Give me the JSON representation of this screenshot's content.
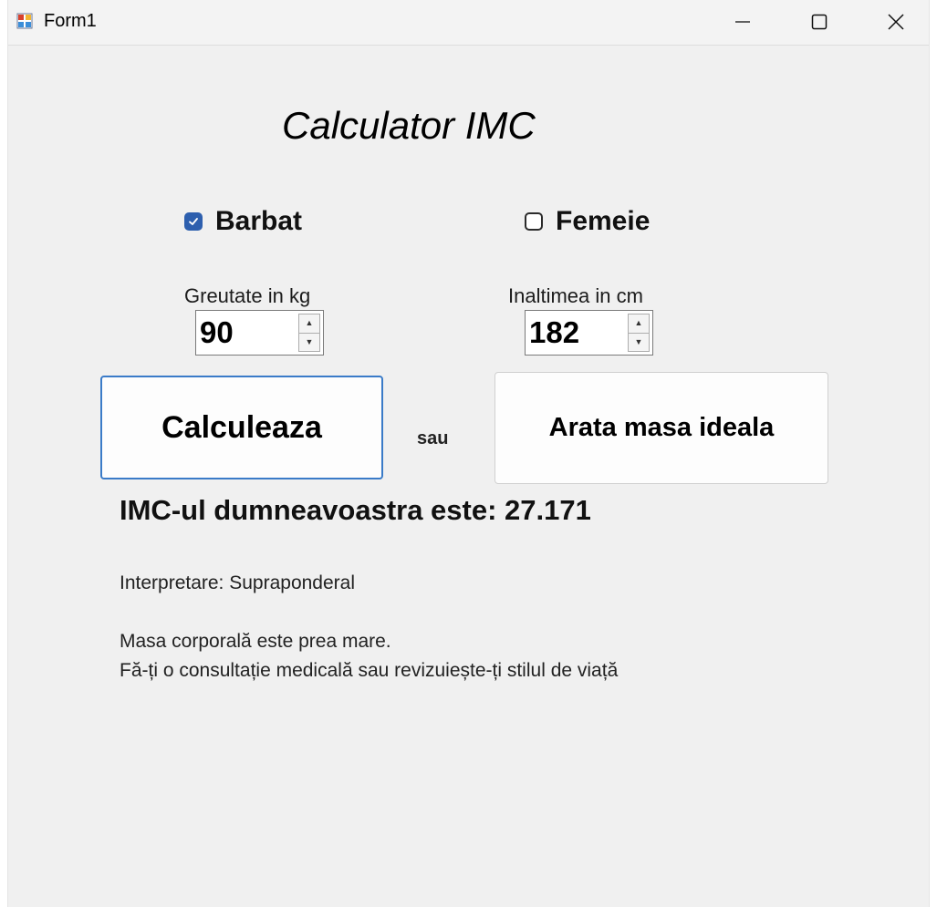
{
  "window": {
    "title": "Form1",
    "icon": "form-app-icon",
    "controls": {
      "minimize_icon": "minimize-icon",
      "maximize_icon": "maximize-icon",
      "close_icon": "close-icon"
    }
  },
  "form": {
    "heading": "Calculator IMC",
    "gender": {
      "male": {
        "label": "Barbat",
        "checked": true
      },
      "female": {
        "label": "Femeie",
        "checked": false
      }
    },
    "weight": {
      "label": "Greutate in kg",
      "value": "90"
    },
    "height": {
      "label": "Inaltimea in cm",
      "value": "182"
    },
    "buttons": {
      "calculate": "Calculeaza",
      "separator": "sau",
      "ideal_mass": "Arata masa ideala"
    },
    "result": {
      "text": "IMC-ul dumneavoastra este: 27.171",
      "interpretation": "Interpretare: Supraponderal",
      "advice_line1": "Masa corporală este prea mare.",
      "advice_line2": "Fă-ți o consultație medicală sau revizuiește-ți stilul de viață"
    }
  },
  "colors": {
    "checkbox_accent": "#2d5fae",
    "primary_button_border": "#3a7bc8",
    "form_background": "#f0f0f0"
  }
}
